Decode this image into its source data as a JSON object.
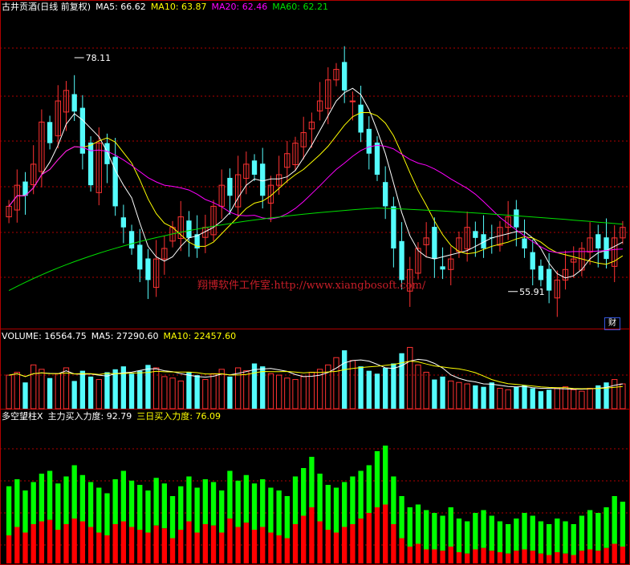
{
  "colors": {
    "up": "#ff3232",
    "down": "#54fcfc",
    "ma5": "#ffffff",
    "ma10": "#ffff00",
    "ma20": "#ff00ff",
    "ma60": "#00e000",
    "frame": "#b00000",
    "grid": "#b00000",
    "green_bar": "#00ff00",
    "red_bar": "#ff0000"
  },
  "header": {
    "stock_name": "古井贡酒(日线 前复权)",
    "ma5": "MA5: 66.62",
    "ma10": "MA10: 63.87",
    "ma20": "MA20: 62.46",
    "ma60": "MA60: 62.21"
  },
  "volume_header": {
    "volume": "VOLUME: 16564.75",
    "ma5": "MA5: 27290.60",
    "ma10": "MA10: 22457.60"
  },
  "indicator_header": {
    "title": "多空望柱X",
    "main_force": "主力买入力度: 92.79",
    "three_day": "三日买入力度: 76.09"
  },
  "watermark": "翔博软件工作室:http://www.xiangbosoft.com/",
  "finance_badge": "财",
  "chart_data": [
    {
      "type": "candlestick",
      "title": "古井贡酒(日线 前复权)",
      "series": [
        {
          "name": "MA5",
          "value": 66.62
        },
        {
          "name": "MA10",
          "value": 63.87
        },
        {
          "name": "MA20",
          "value": 62.46
        },
        {
          "name": "MA60",
          "value": 62.21
        }
      ],
      "annotations": [
        {
          "text": "78.11",
          "label": "high"
        },
        {
          "text": "55.91",
          "label": "low"
        }
      ],
      "ylim": [
        53,
        81
      ],
      "close_path": [
        64,
        66,
        65,
        68,
        72,
        70,
        74,
        75,
        73,
        69,
        66,
        70,
        68,
        64,
        62,
        60,
        58,
        57,
        59,
        60,
        62,
        63,
        61,
        60,
        62,
        64,
        66,
        65,
        67,
        68,
        67,
        65,
        66,
        67,
        69,
        70,
        71,
        72,
        74,
        76,
        77,
        75,
        74,
        71,
        69,
        67,
        64,
        60,
        57,
        58,
        60,
        61,
        59,
        58,
        59,
        61,
        62,
        61,
        60,
        61,
        62,
        63,
        62,
        60,
        58,
        57,
        56,
        57,
        58,
        59,
        60,
        61,
        60,
        59,
        61,
        62
      ],
      "high_marker": {
        "index": 8,
        "price": 78.11
      },
      "low_marker": {
        "index": 61,
        "price": 55.91
      },
      "grid": true
    },
    {
      "type": "bar",
      "title": "VOLUME",
      "series": [
        {
          "name": "VOLUME",
          "value": 16564.75
        },
        {
          "name": "MA5",
          "value": 27290.6
        },
        {
          "name": "MA10",
          "value": 22457.6
        }
      ],
      "values": [
        23,
        25,
        18,
        30,
        27,
        21,
        24,
        28,
        19,
        26,
        22,
        20,
        25,
        27,
        29,
        24,
        26,
        30,
        28,
        22,
        21,
        19,
        25,
        23,
        20,
        24,
        27,
        22,
        28,
        26,
        31,
        29,
        24,
        23,
        21,
        20,
        22,
        25,
        27,
        30,
        35,
        40,
        33,
        29,
        26,
        24,
        28,
        31,
        38,
        42,
        30,
        25,
        20,
        22,
        19,
        18,
        17,
        16,
        15,
        18,
        14,
        13,
        15,
        16,
        14,
        12,
        13,
        14,
        15,
        13,
        12,
        14,
        16,
        18,
        20,
        17
      ],
      "ylim": [
        0,
        45
      ]
    },
    {
      "type": "bar",
      "title": "多空望柱X",
      "series": [
        {
          "name": "主力买入力度",
          "value": 92.79
        },
        {
          "name": "三日买入力度",
          "value": 76.09
        }
      ],
      "total_values": [
        55,
        60,
        52,
        58,
        64,
        66,
        57,
        62,
        70,
        63,
        58,
        54,
        50,
        60,
        66,
        59,
        56,
        52,
        61,
        57,
        48,
        55,
        62,
        54,
        60,
        58,
        52,
        66,
        59,
        63,
        57,
        60,
        54,
        52,
        48,
        62,
        68,
        76,
        64,
        56,
        54,
        58,
        62,
        66,
        70,
        80,
        84,
        62,
        48,
        40,
        42,
        38,
        36,
        34,
        40,
        32,
        30,
        36,
        38,
        34,
        30,
        28,
        32,
        36,
        34,
        30,
        28,
        32,
        30,
        28,
        34,
        38,
        36,
        40,
        48,
        44
      ],
      "red_values": [
        20,
        26,
        22,
        28,
        30,
        31,
        24,
        28,
        32,
        30,
        26,
        22,
        20,
        28,
        30,
        26,
        24,
        22,
        27,
        25,
        18,
        24,
        30,
        22,
        28,
        27,
        22,
        32,
        26,
        29,
        24,
        26,
        22,
        20,
        18,
        28,
        34,
        40,
        30,
        24,
        22,
        26,
        28,
        32,
        36,
        40,
        42,
        28,
        18,
        12,
        14,
        10,
        10,
        9,
        12,
        8,
        7,
        10,
        11,
        9,
        8,
        7,
        9,
        10,
        9,
        7,
        6,
        8,
        7,
        6,
        9,
        10,
        9,
        11,
        14,
        12
      ],
      "ylim": [
        0,
        100
      ]
    }
  ]
}
